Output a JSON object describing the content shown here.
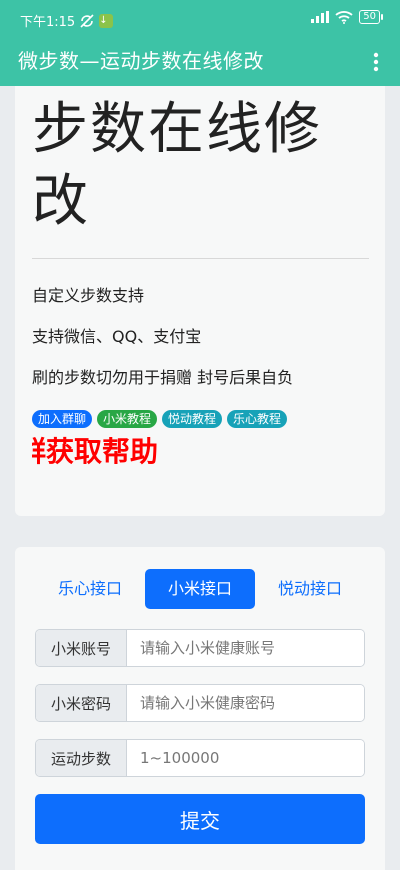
{
  "status_bar": {
    "time": "下午1:15",
    "battery_label": "50"
  },
  "app_bar": {
    "title": "微步数—运动步数在线修改"
  },
  "intro": {
    "title": "步数在线修改",
    "features": [
      "自定义步数支持",
      "支持微信、QQ、支付宝",
      "刷的步数切勿用于捐赠 封号后果自负"
    ],
    "badges": [
      {
        "label": "加入群聊",
        "color": "#0d6efd"
      },
      {
        "label": "小米教程",
        "color": "#28a745"
      },
      {
        "label": "悦动教程",
        "color": "#17a2b8"
      },
      {
        "label": "乐心教程",
        "color": "#17a2b8"
      }
    ],
    "help_text": "群获取帮助"
  },
  "form": {
    "tabs": [
      {
        "label": "乐心接口"
      },
      {
        "label": "小米接口"
      },
      {
        "label": "悦动接口"
      }
    ],
    "fields": [
      {
        "label": "小米账号",
        "value": "",
        "placeholder": "请输入小米健康账号"
      },
      {
        "label": "小米密码",
        "value": "",
        "placeholder": "请输入小米健康密码"
      },
      {
        "label": "运动步数",
        "value": "",
        "placeholder": "1~100000"
      }
    ],
    "submit_label": "提交"
  },
  "colors": {
    "appbar": "#3dc3a6",
    "primary": "#0d6efd",
    "help": "#ff0000"
  }
}
